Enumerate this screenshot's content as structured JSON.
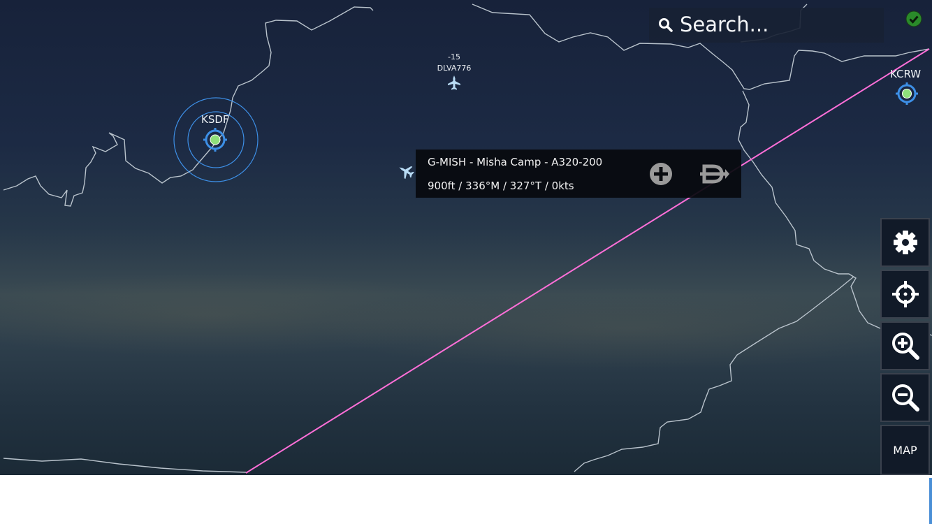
{
  "search": {
    "placeholder": "Search...",
    "icon": "search-icon"
  },
  "status": {
    "icon": "check-circle-icon",
    "color": "#3bbf3b"
  },
  "airports": [
    {
      "code": "KSDF",
      "icon": "airport-target-icon"
    },
    {
      "code": "KCRW",
      "icon": "airport-target-icon"
    }
  ],
  "traffic": {
    "altitude_diff": "-15",
    "callsign": "DLVA776",
    "icon": "airplane-icon"
  },
  "popup": {
    "title": "G-MISH - Misha Camp - A320-200",
    "details": "900ft / 336°M / 327°T / 0kts",
    "add_icon": "plus-circle-icon",
    "connect_icon": "plug-icon"
  },
  "sidebar": {
    "settings_icon": "gear-icon",
    "center_icon": "crosshair-icon",
    "zoom_in_icon": "zoom-in-icon",
    "zoom_out_icon": "zoom-out-icon",
    "map_label": "MAP"
  },
  "colors": {
    "route": "#ff6fd8",
    "border": "#b9c3cc",
    "airport_ring": "#3d8fe6",
    "airport_dot": "#8fe07a"
  }
}
